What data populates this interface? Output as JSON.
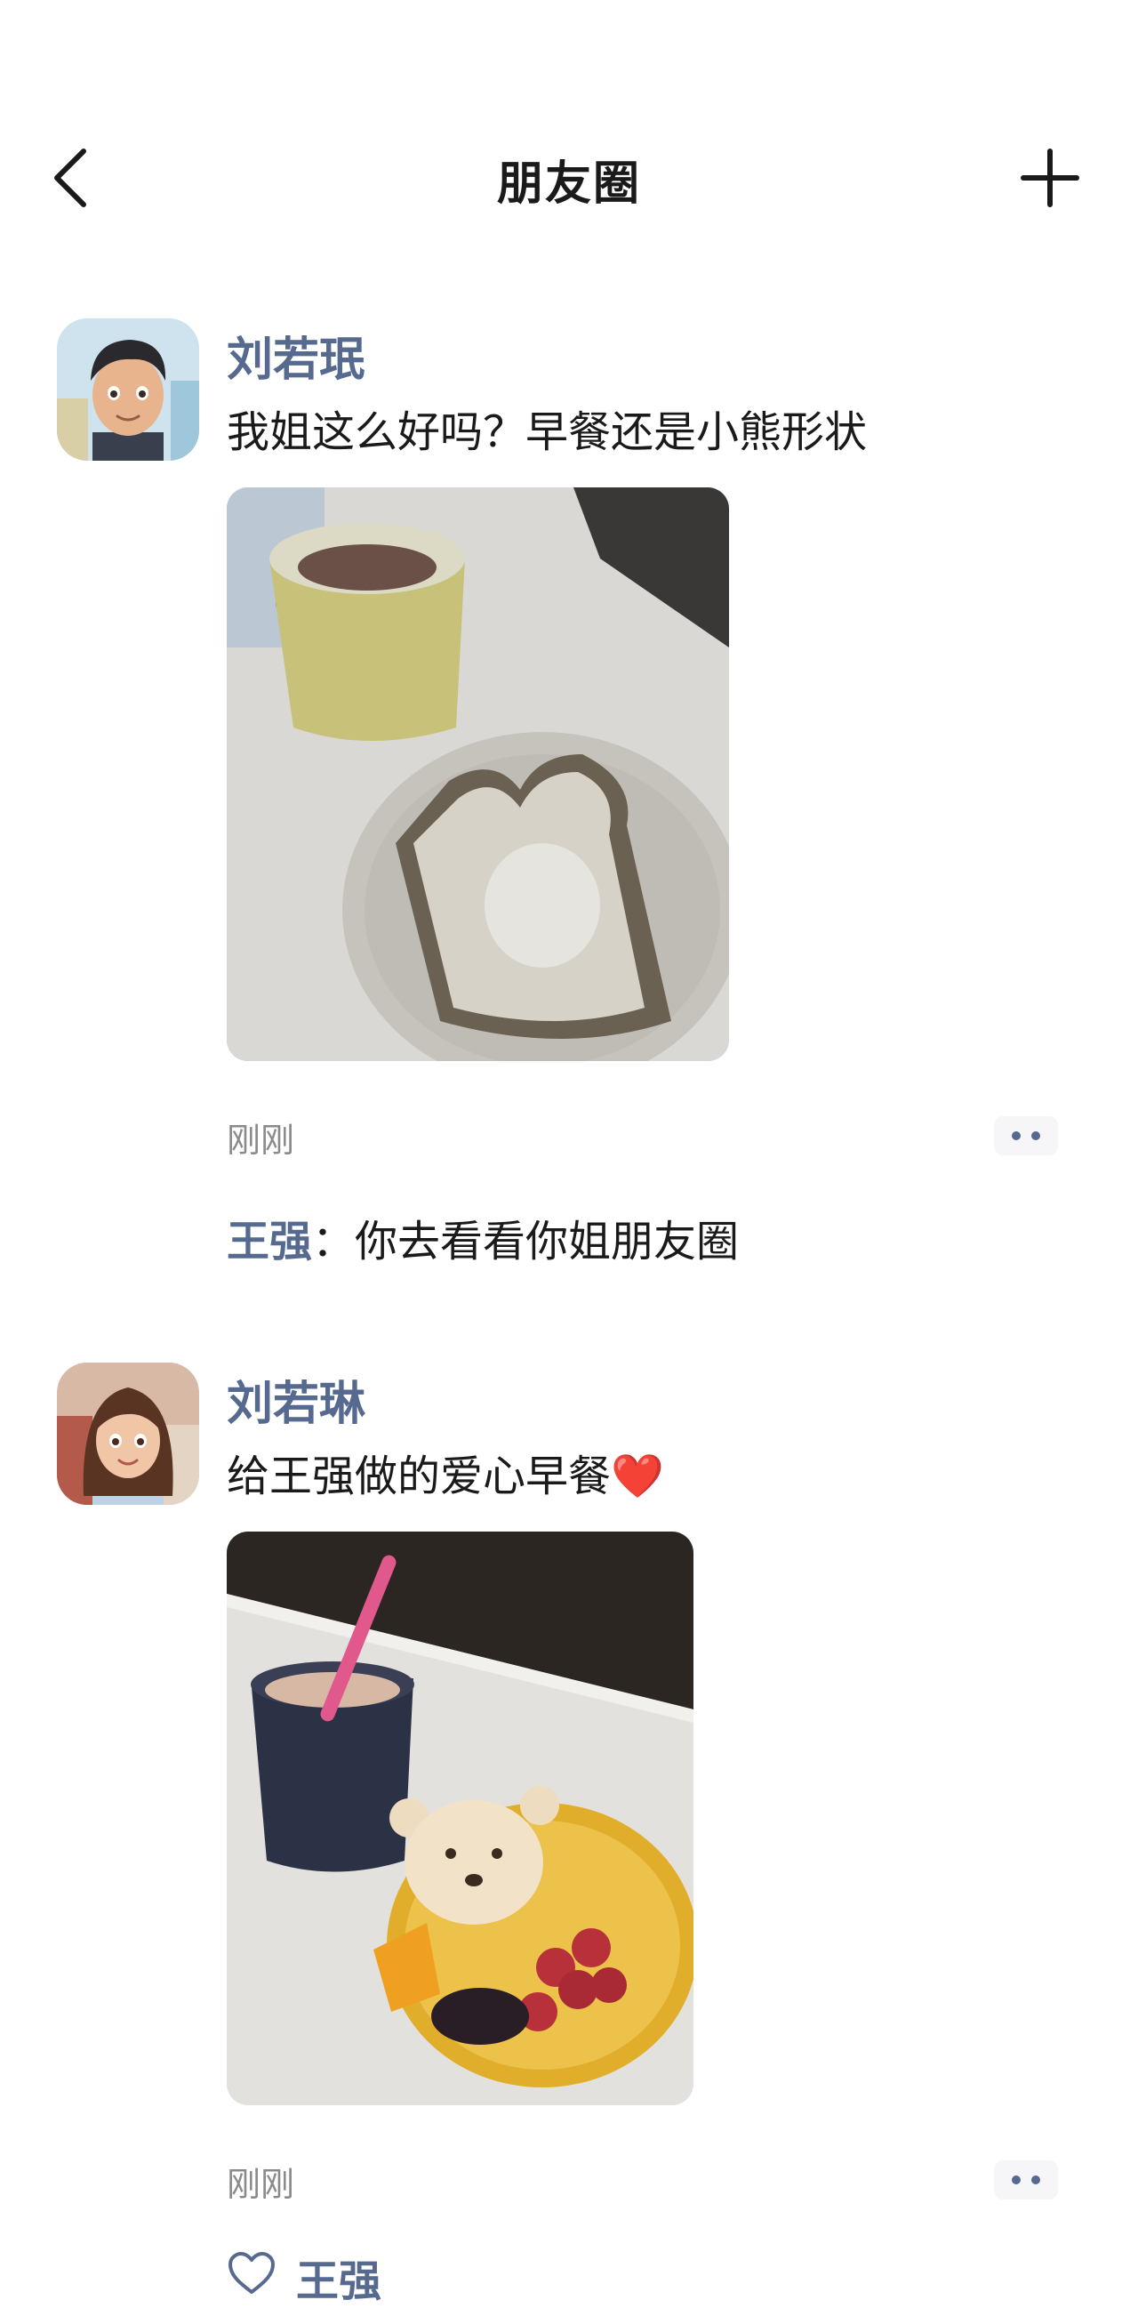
{
  "header": {
    "title": "朋友圈",
    "back_icon": "chevron-left-icon",
    "add_icon": "plus-icon"
  },
  "colors": {
    "link": "#56698f",
    "text": "#1a1a1a",
    "muted": "#8a8a8a",
    "background": "#ffffff"
  },
  "posts": [
    {
      "author": "刘若珉",
      "text": "我姐这么好吗？早餐还是小熊形状",
      "time": "刚刚",
      "comments": [
        {
          "author": "王强",
          "separator": "：",
          "text": "你去看看你姐朋友圈"
        }
      ]
    },
    {
      "author": "刘若琳",
      "text": "给王强做的爱心早餐❤️",
      "time": "刚刚",
      "likes": [
        "王强"
      ]
    }
  ]
}
